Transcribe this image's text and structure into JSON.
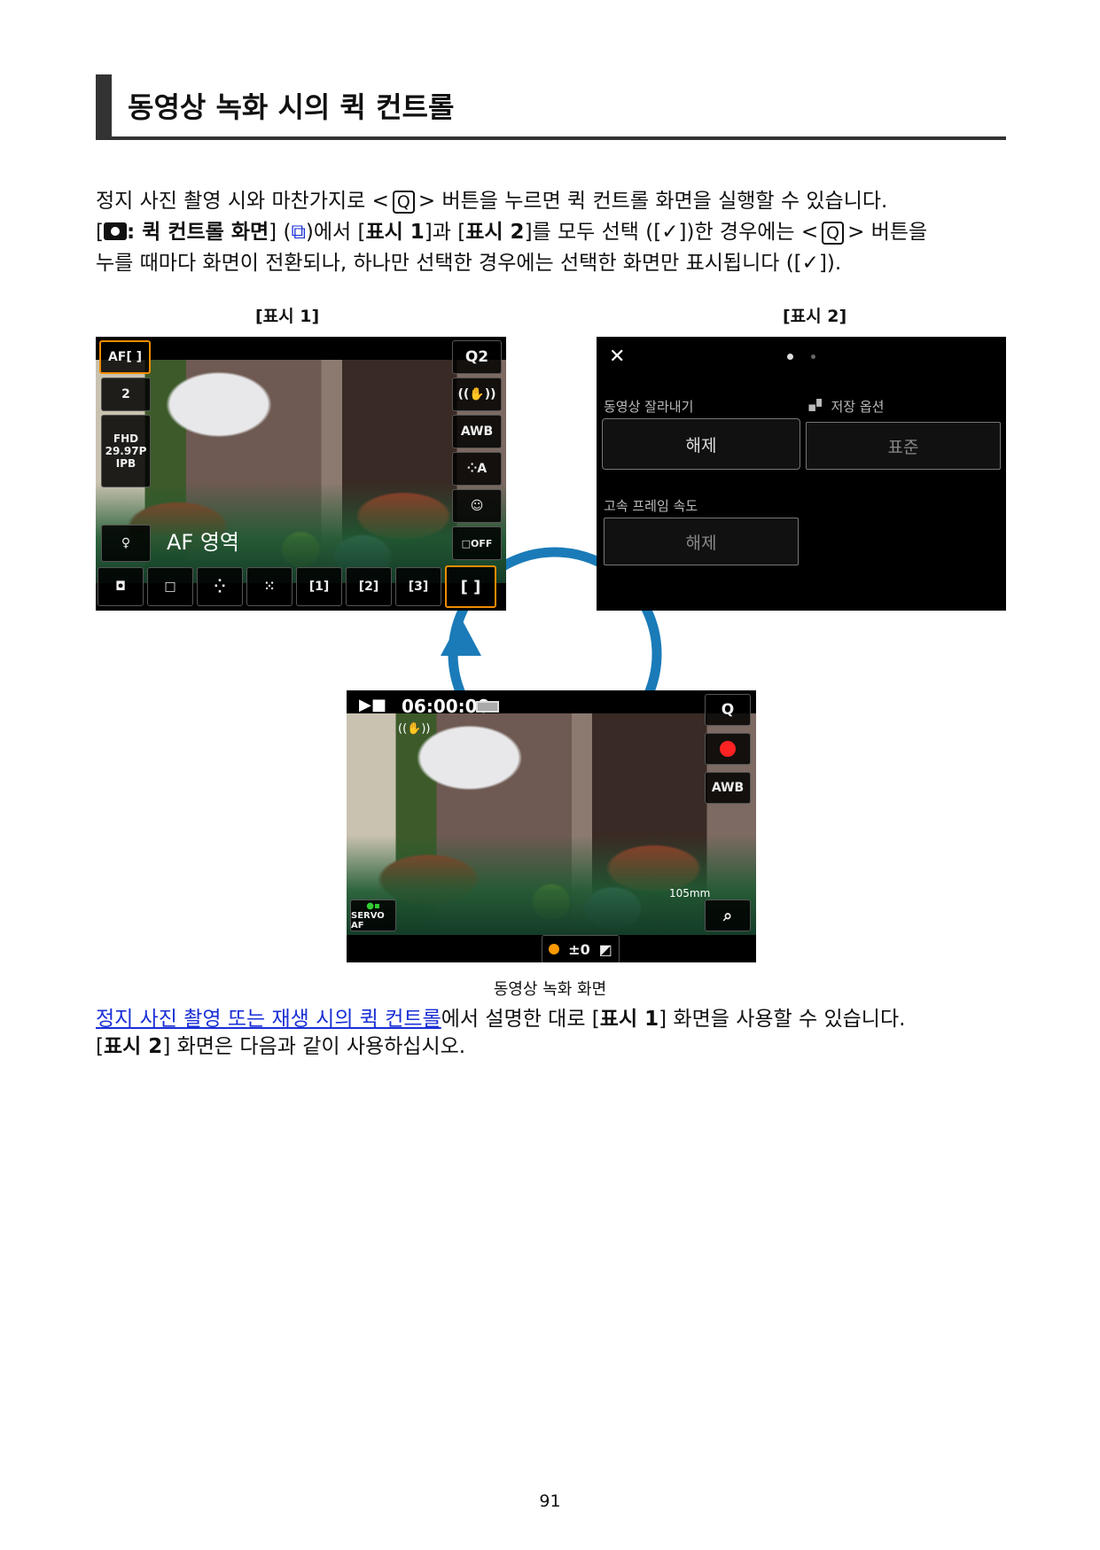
{
  "heading": "동영상 녹화 시의 퀵 컨트롤",
  "intro": {
    "l1a": "정지 사진 촬영 시와 마찬가지로 <",
    "q": "Q",
    "l1b": "> 버튼을 누르면 퀵 컨트롤 화면을 실행할 수 있습니다.",
    "l2a": "[",
    "l2menu": ": 퀵 컨트롤 화면",
    "l2b": "] (",
    "l2c": ")에서 [",
    "d1": "표시 1",
    "l2d": "]과 [",
    "d2": "표시 2",
    "l2e": "]를 모두 선택 ([",
    "check": "✓",
    "l2f": "])한 경우에는 <",
    "l2g": "> 버튼을",
    "l3a": "누를 때마다 화면이 전환되나, 하나만 선택한 경우에는 선택한 화면만 표시됩니다 ([",
    "l3b": "])."
  },
  "labels": {
    "display1": "[표시 1]",
    "display2": "[표시 2]"
  },
  "screen1": {
    "left": [
      "AF[ ]",
      "2",
      "FHD",
      "29.97P",
      "IPB"
    ],
    "right": [
      "Q2",
      "((✋))",
      "AWB",
      "⁘A",
      "☺",
      "□OFF"
    ],
    "af_label": "AF 영역",
    "bottom": [
      "◘",
      "□",
      "⁛",
      "⁙",
      "[1]",
      "[2]",
      "[3]",
      "[ ]"
    ]
  },
  "screen2": {
    "close": "✕",
    "crop_label": "동영상 잘라내기",
    "crop_value": "해제",
    "save_label": "저장 옵션",
    "save_value": "표준",
    "hfr_label": "고속 프레임 속도",
    "hfr_value": "해제"
  },
  "screen3": {
    "time": "06:00:00",
    "q": "Q",
    "awb": "AWB",
    "focal": "105mm",
    "servo": "SERVO AF",
    "exposure": "±0"
  },
  "caption": "동영상 녹화 화면",
  "outro": {
    "link": "정지 사진 촬영 또는 재생 시의 퀵 컨트롤",
    "l1a": "에서 설명한 대로 [",
    "d1": "표시 1",
    "l1b": "] 화면을 사용할 수 있습니다.",
    "l2a": "[",
    "d2": "표시 2",
    "l2b": "] 화면은 다음과 같이 사용하십시오."
  },
  "page_number": "91",
  "colors": {
    "accent": "#f08c00",
    "arrow": "#1a7bb8",
    "link": "#1a2fd6"
  }
}
